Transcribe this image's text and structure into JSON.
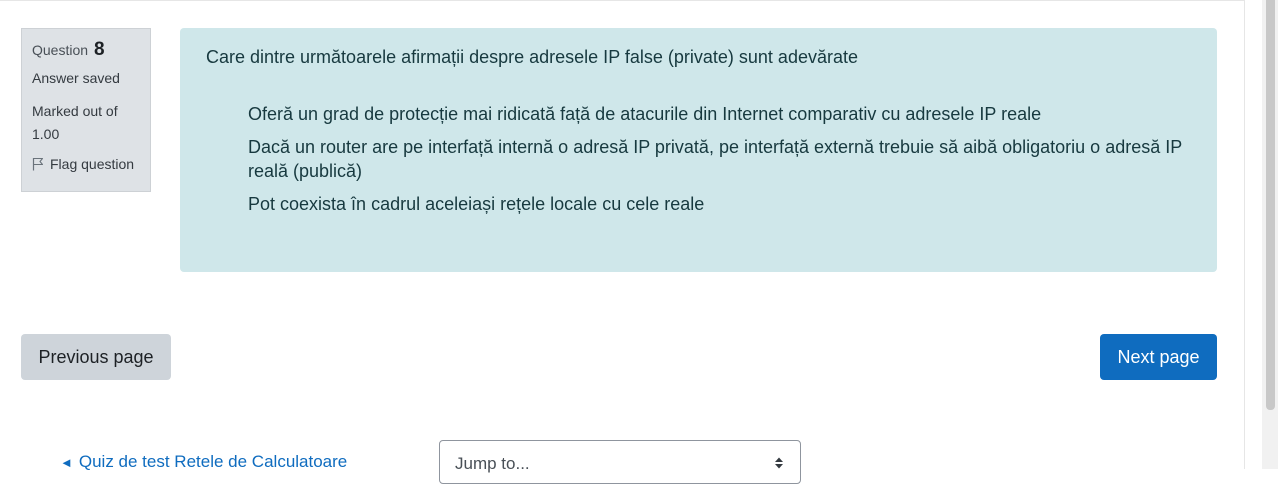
{
  "question_info": {
    "label": "Question",
    "number": "8",
    "state": "Answer saved",
    "grade": "Marked out of 1.00",
    "flag_label": "Flag question"
  },
  "question": {
    "text": "Care dintre următoarele afirmații despre adresele IP false (private) sunt adevărate",
    "answers": [
      "Oferă un grad de protecție mai ridicată față de atacurile din Internet comparativ cu adresele IP reale",
      "Dacă un router are pe interfață internă o adresă IP privată, pe interfață externă trebuie să aibă obligatoriu o adresă IP reală (publică)",
      "Pot coexista în cadrul aceleiași rețele locale cu cele reale"
    ]
  },
  "navigation": {
    "previous_label": "Previous page",
    "next_label": "Next page"
  },
  "activity_nav": {
    "prev_arrow": "◄",
    "prev_activity": "Quiz de test Retele de Calculatoare",
    "jump_to": "Jump to..."
  },
  "colors": {
    "accent": "#0f6cbf",
    "formulation_bg": "#cfe7ea",
    "info_bg": "#dee2e6"
  },
  "icons": {
    "flag": "flag-icon",
    "select_caret": "sort-caret-icon"
  }
}
